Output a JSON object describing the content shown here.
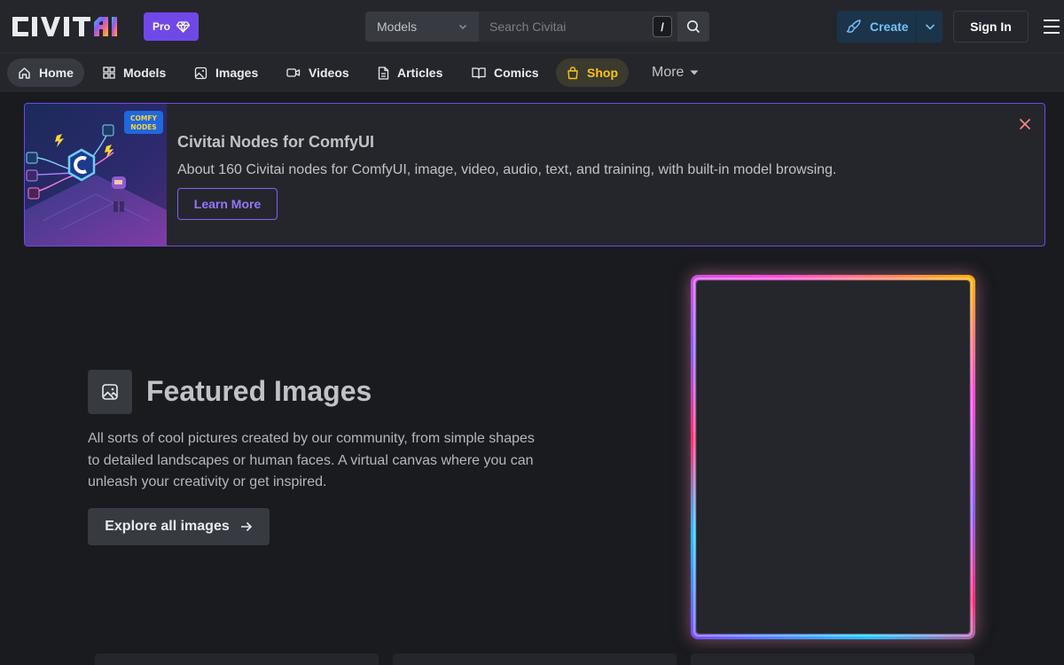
{
  "header": {
    "logo_text": "CIVITAI",
    "pro_label": "Pro",
    "search": {
      "type_value": "Models",
      "placeholder": "Search Civitai",
      "shortcut": "/"
    },
    "create_label": "Create",
    "signin_label": "Sign In"
  },
  "nav": {
    "items": [
      {
        "label": "Home",
        "icon": "home-icon"
      },
      {
        "label": "Models",
        "icon": "grid-icon"
      },
      {
        "label": "Images",
        "icon": "photo-icon"
      },
      {
        "label": "Videos",
        "icon": "video-icon"
      },
      {
        "label": "Articles",
        "icon": "article-icon"
      },
      {
        "label": "Comics",
        "icon": "book-icon"
      },
      {
        "label": "Shop",
        "icon": "shopping-bag-icon"
      }
    ],
    "more_label": "More"
  },
  "banner": {
    "title": "Civitai Nodes for ComfyUI",
    "description": "About 160 Civitai nodes for ComfyUI, image, video, audio, text, and training, with built-in model browsing.",
    "button_label": "Learn More",
    "image_badge": "COMFY NODES"
  },
  "featured": {
    "title": "Featured Images",
    "description": "All sorts of cool pictures created by our community, from simple shapes to detailed landscapes or human faces. A virtual canvas where you can unleash your creativity or get inspired.",
    "button_label": "Explore all images"
  },
  "colors": {
    "background": "#1a1b1e",
    "surface": "#25262b",
    "accent": "#7048e8",
    "create_text": "#74c0fc",
    "shop_text": "#fcc419"
  }
}
